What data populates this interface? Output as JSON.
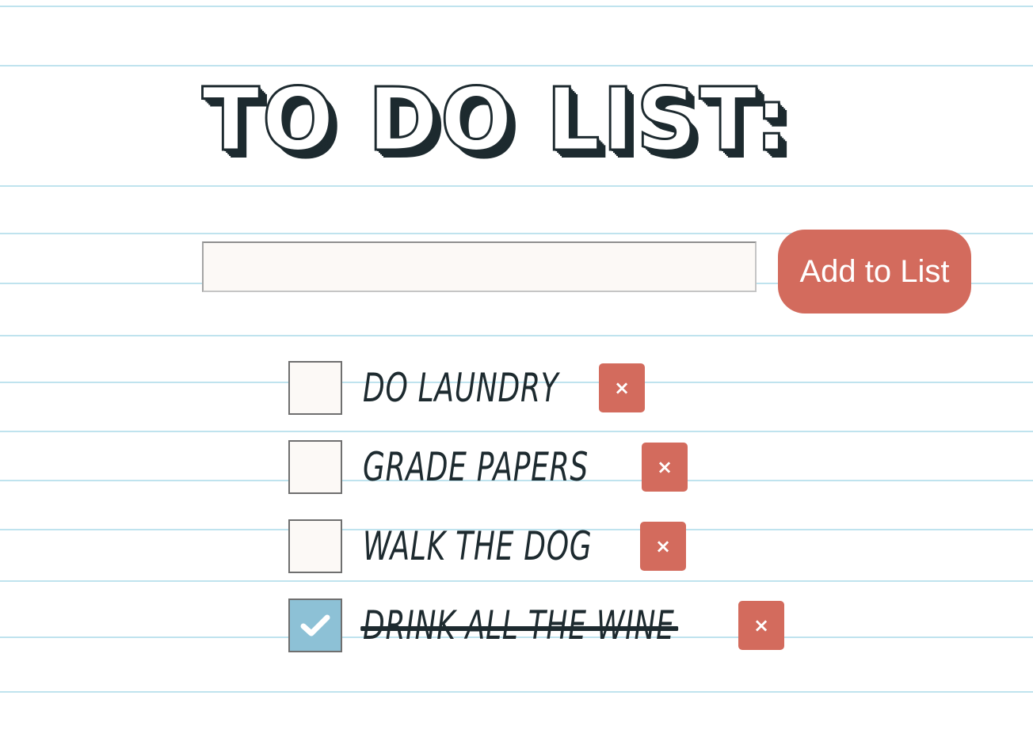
{
  "page": {
    "title": "TO DO LIST:"
  },
  "form": {
    "input_value": "",
    "input_placeholder": "",
    "add_label": "Add to List"
  },
  "todos": [
    {
      "text": "DO LAUNDRY",
      "checked": false,
      "delete_label": "×"
    },
    {
      "text": "GRADE PAPERS",
      "checked": false,
      "delete_label": "×"
    },
    {
      "text": "WALK THE DOG",
      "checked": false,
      "delete_label": "×"
    },
    {
      "text": "DRINK ALL THE WINE",
      "checked": true,
      "delete_label": "×"
    }
  ],
  "icons": {
    "checkmark": "check-icon",
    "delete": "close-icon"
  },
  "colors": {
    "accent": "#d36b5d",
    "ink": "#1d2a2f",
    "checked_fill": "#8dc1d6",
    "rule_line": "#bfe3ee",
    "field_fill": "#fcf9f6"
  }
}
